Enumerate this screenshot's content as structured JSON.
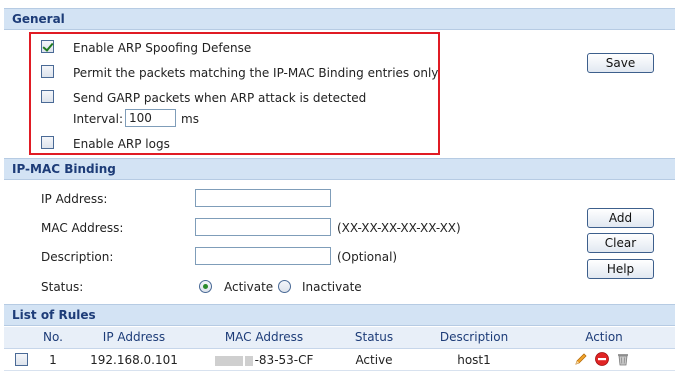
{
  "general": {
    "title": "General",
    "enable_arp_spoofing": {
      "label": "Enable ARP Spoofing Defense",
      "checked": true
    },
    "permit_ip_mac": {
      "label": "Permit the packets matching the IP-MAC Binding entries only",
      "checked": false
    },
    "send_garp": {
      "label": "Send GARP packets when ARP attack is detected",
      "checked": false
    },
    "interval_label": "Interval:",
    "interval_value": "100",
    "interval_unit": "ms",
    "enable_arp_logs": {
      "label": "Enable ARP logs",
      "checked": false
    },
    "save_label": "Save"
  },
  "ip_mac_binding": {
    "title": "IP-MAC Binding",
    "ip_label": "IP Address:",
    "ip_value": "",
    "mac_label": "MAC Address:",
    "mac_value": "",
    "mac_hint": "(XX-XX-XX-XX-XX-XX)",
    "description_label": "Description:",
    "description_value": "",
    "description_hint": "(Optional)",
    "status_label": "Status:",
    "status_options": [
      "Activate",
      "Inactivate"
    ],
    "status_selected": "Activate",
    "add_label": "Add",
    "clear_label": "Clear",
    "help_label": "Help"
  },
  "rules": {
    "title": "List of Rules",
    "columns": [
      "No.",
      "IP Address",
      "MAC Address",
      "Status",
      "Description",
      "Action"
    ],
    "rows": [
      {
        "no": "1",
        "ip": "192.168.0.101",
        "mac_visible": "-83-53-CF",
        "status": "Active",
        "description": "host1",
        "selected": false
      }
    ],
    "action_icons": [
      "edit-pencil-icon",
      "delete-icon",
      "trash-icon"
    ]
  },
  "colors": {
    "header_bg": "#d3e3f4",
    "header_text": "#1d3c78",
    "highlight_border": "#e01b24"
  }
}
